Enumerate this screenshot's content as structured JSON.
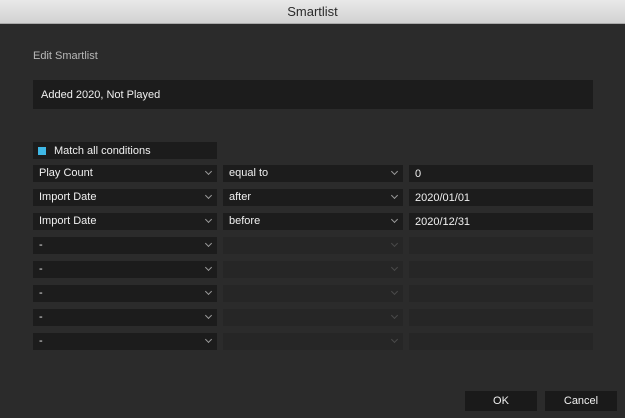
{
  "window": {
    "title": "Smartlist"
  },
  "section_label": "Edit Smartlist",
  "name_value": "Added 2020, Not Played",
  "match_all_label": "Match all conditions",
  "accent_color": "#3fb8e6",
  "conditions": [
    {
      "field": "Play Count",
      "operator": "equal to",
      "value": "0",
      "enabled": true
    },
    {
      "field": "Import Date",
      "operator": "after",
      "value": "2020/01/01",
      "enabled": true
    },
    {
      "field": "Import Date",
      "operator": "before",
      "value": "2020/12/31",
      "enabled": true
    },
    {
      "field": "-",
      "operator": "",
      "value": "",
      "enabled": false
    },
    {
      "field": "-",
      "operator": "",
      "value": "",
      "enabled": false
    },
    {
      "field": "-",
      "operator": "",
      "value": "",
      "enabled": false
    },
    {
      "field": "-",
      "operator": "",
      "value": "",
      "enabled": false
    },
    {
      "field": "-",
      "operator": "",
      "value": "",
      "enabled": false
    }
  ],
  "buttons": {
    "ok": "OK",
    "cancel": "Cancel"
  }
}
